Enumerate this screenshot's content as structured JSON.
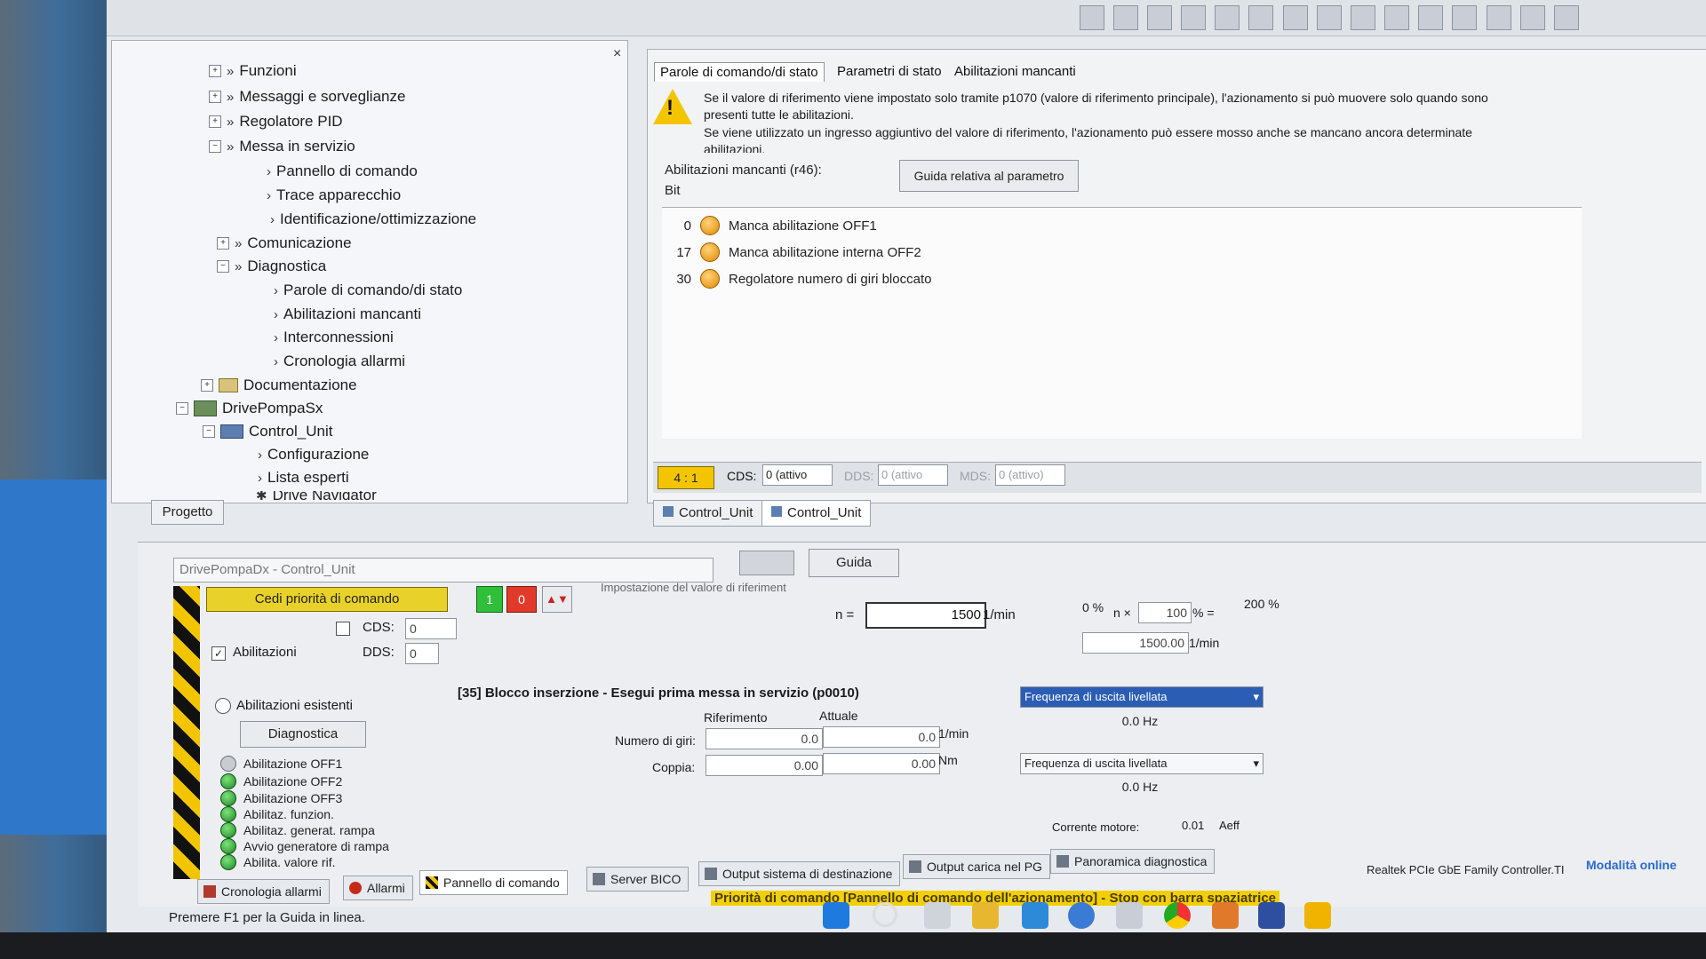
{
  "tree": {
    "items": [
      {
        "label": "Funzioni"
      },
      {
        "label": "Messaggi e sorveglianze"
      },
      {
        "label": "Regolatore PID"
      },
      {
        "label": "Messa in servizio"
      },
      {
        "label": "Pannello di comando"
      },
      {
        "label": "Trace apparecchio"
      },
      {
        "label": "Identificazione/ottimizzazione"
      },
      {
        "label": "Comunicazione"
      },
      {
        "label": "Diagnostica"
      },
      {
        "label": "Parole di comando/di stato"
      },
      {
        "label": "Abilitazioni mancanti"
      },
      {
        "label": "Interconnessioni"
      },
      {
        "label": "Cronologia allarmi"
      },
      {
        "label": "Documentazione"
      },
      {
        "label": "DrivePompaSx"
      },
      {
        "label": "Control_Unit"
      },
      {
        "label": "Configurazione"
      },
      {
        "label": "Lista esperti"
      },
      {
        "label": "Drive Navigator"
      }
    ],
    "close": "×",
    "tab_label": "Progetto"
  },
  "detail": {
    "tabs": [
      "Parole di comando/di stato",
      "Parametri di stato",
      "Abilitazioni mancanti"
    ],
    "warning_lines": [
      "Se il valore di riferimento viene impostato solo tramite p1070 (valore di riferimento principale), l'azionamento si può muovere solo quando sono",
      "presenti tutte le abilitazioni.",
      "Se viene utilizzato un ingresso aggiuntivo del valore di riferimento, l'azionamento può essere mosso anche se mancano ancora determinate",
      "abilitazioni."
    ],
    "missing_label": "Abilitazioni mancanti (r46):",
    "bit_label": "Bit",
    "guide_param_button": "Guida relativa al parametro",
    "bits": [
      {
        "bit": "0",
        "text": "Manca abilitazione OFF1"
      },
      {
        "bit": "17",
        "text": "Manca abilitazione interna OFF2"
      },
      {
        "bit": "30",
        "text": "Regolatore numero di giri bloccato"
      }
    ],
    "strip": {
      "indicator": "4 : 1",
      "cds_label": "CDS:",
      "cds_value": "0 (attivo",
      "dds_label": "DDS:",
      "dds_value": "0 (attivo",
      "mds_label": "MDS:",
      "mds_value": "0 (attivo)"
    },
    "unit_tabs": [
      "Control_Unit",
      "Control_Unit"
    ]
  },
  "control": {
    "device": "DrivePompaDx - Control_Unit",
    "guida": "Guida",
    "cede_button": "Cedi priorità di comando",
    "btn_one": "1",
    "btn_zero": "0",
    "btn_arrows": "▲▼",
    "cds_label": "CDS:",
    "cds_value": "0",
    "dds_label": "DDS:",
    "dds_value": "0",
    "abilitazioni_label": "Abilitazioni",
    "setpoint_label": "Impostazione del valore di riferiment",
    "n_label": "n =",
    "n_value": "1500",
    "n_unit": "1/min",
    "pct_low": "0 %",
    "pct_high": "200 %",
    "n_x_label": "n ×",
    "pct_value": "100",
    "pct_eq": "% =",
    "result_value": "1500.00",
    "result_unit": "1/min",
    "existing_label": "Abilitazioni esistenti",
    "diag_button": "Diagnostica",
    "block_message": "[35] Blocco inserzione - Esegui prima messa in servizio (p0010)",
    "col_ref": "Riferimento",
    "col_act": "Attuale",
    "speed_label": "Numero di giri:",
    "speed_ref": "0.0",
    "speed_act": "0.0",
    "speed_unit": "1/min",
    "torque_label": "Coppia:",
    "torque_ref": "0.00",
    "torque_act": "0.00",
    "torque_unit": "Nm",
    "freq_sel_1": "Frequenza di uscita livellata",
    "freq_val_1": "0.0 Hz",
    "freq_sel_2": "Frequenza di uscita livellata",
    "freq_val_2": "0.0 Hz",
    "current_label": "Corrente motore:",
    "current_value": "0.01",
    "current_unit": "Aeff",
    "leds": [
      {
        "label": "Abilitazione OFF1",
        "on": false
      },
      {
        "label": "Abilitazione OFF2",
        "on": true
      },
      {
        "label": "Abilitazione OFF3",
        "on": true
      },
      {
        "label": "Abilitaz. funzion.",
        "on": true
      },
      {
        "label": "Abilitaz. generat. rampa",
        "on": true
      },
      {
        "label": "Avvio generatore di rampa",
        "on": true
      },
      {
        "label": "Abilita. valore rif.",
        "on": true
      }
    ]
  },
  "bottom_tabs": [
    "Cronologia allarmi",
    "Allarmi",
    "Pannello di comando",
    "Server BICO",
    "Output sistema di destinazione",
    "Output carica nel PG",
    "Panoramica diagnostica"
  ],
  "status": {
    "network": "Realtek PCIe GbE Family Controller.TI",
    "mode": "Modalità online",
    "priority_message": "Priorità di comando [Pannello di comando dell'azionamento] - Stop con barra spaziatrice",
    "help": "Premere F1 per la Guida in linea."
  },
  "colors": {
    "hazard_yellow": "#f2c500",
    "selection_blue": "#2b5db5",
    "led_orange": "#e08a00",
    "led_green": "#1c8a26"
  }
}
